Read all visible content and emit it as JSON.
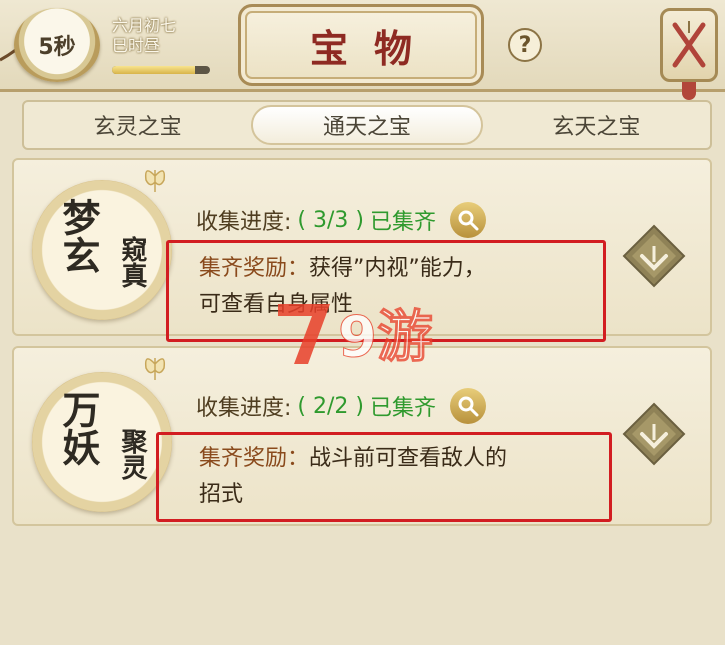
{
  "header": {
    "timer": "5秒",
    "date_line1": "六月初七",
    "date_line2": "巳时昼",
    "time_progress": 0.85,
    "title": "宝物",
    "help_label": "?"
  },
  "tabs": [
    {
      "label": "玄灵之宝",
      "active": false
    },
    {
      "label": "通天之宝",
      "active": true
    },
    {
      "label": "玄天之宝",
      "active": false
    }
  ],
  "treasures": [
    {
      "emblem_big": "梦玄",
      "emblem_small": "窥真",
      "progress_label": "收集进度:",
      "progress_count": "( 3/3 )",
      "progress_status": "已集齐",
      "reward_label": "集齐奖励：",
      "reward_text": "获得”内视”能力，",
      "reward_text2": "可查看自身属性"
    },
    {
      "emblem_big": "万妖",
      "emblem_small": "聚灵",
      "progress_label": "收集进度:",
      "progress_count": "( 2/2 )",
      "progress_status": "已集齐",
      "reward_label": "集齐奖励：",
      "reward_text": "战斗前可查看敌人的",
      "reward_text2": "招式"
    }
  ],
  "watermark": "9游",
  "colors": {
    "accent_red": "#d21d21",
    "title_red": "#8e2a22",
    "progress_green": "#2f9a2e",
    "watermark_red": "#e8402a"
  }
}
